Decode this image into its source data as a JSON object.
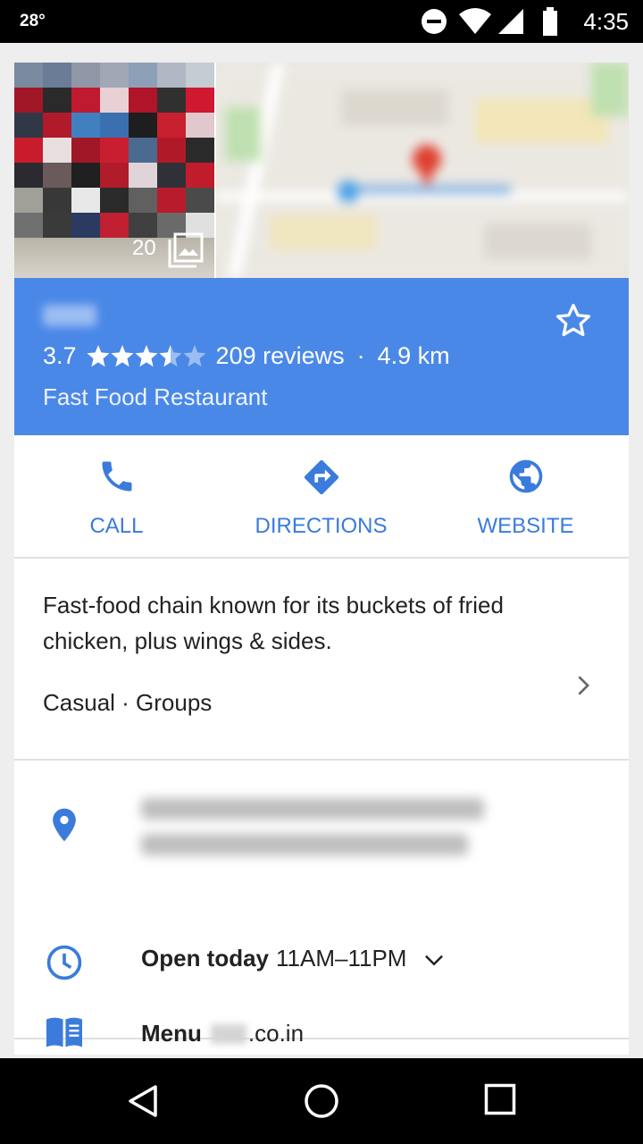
{
  "status_bar": {
    "temperature": "28°",
    "time": "4:35"
  },
  "photo": {
    "count": "20"
  },
  "place": {
    "rating": "3.7",
    "rating_value": 3.7,
    "reviews": "209 reviews",
    "separator": "·",
    "distance": "4.9 km",
    "category": "Fast Food Restaurant"
  },
  "actions": [
    {
      "label": "CALL",
      "icon": "phone-icon"
    },
    {
      "label": "DIRECTIONS",
      "icon": "directions-icon"
    },
    {
      "label": "WEBSITE",
      "icon": "globe-icon"
    }
  ],
  "description": {
    "text": "Fast-food chain known for its buckets of fried chicken, plus wings & sides.",
    "tags": "Casual · Groups"
  },
  "info": {
    "hours_label": "Open today",
    "hours_value": "11AM–11PM",
    "menu_label": "Menu",
    "menu_domain": ".co.in"
  },
  "colors": {
    "accent": "#4a88e8",
    "action_blue": "#3a7bdc"
  }
}
